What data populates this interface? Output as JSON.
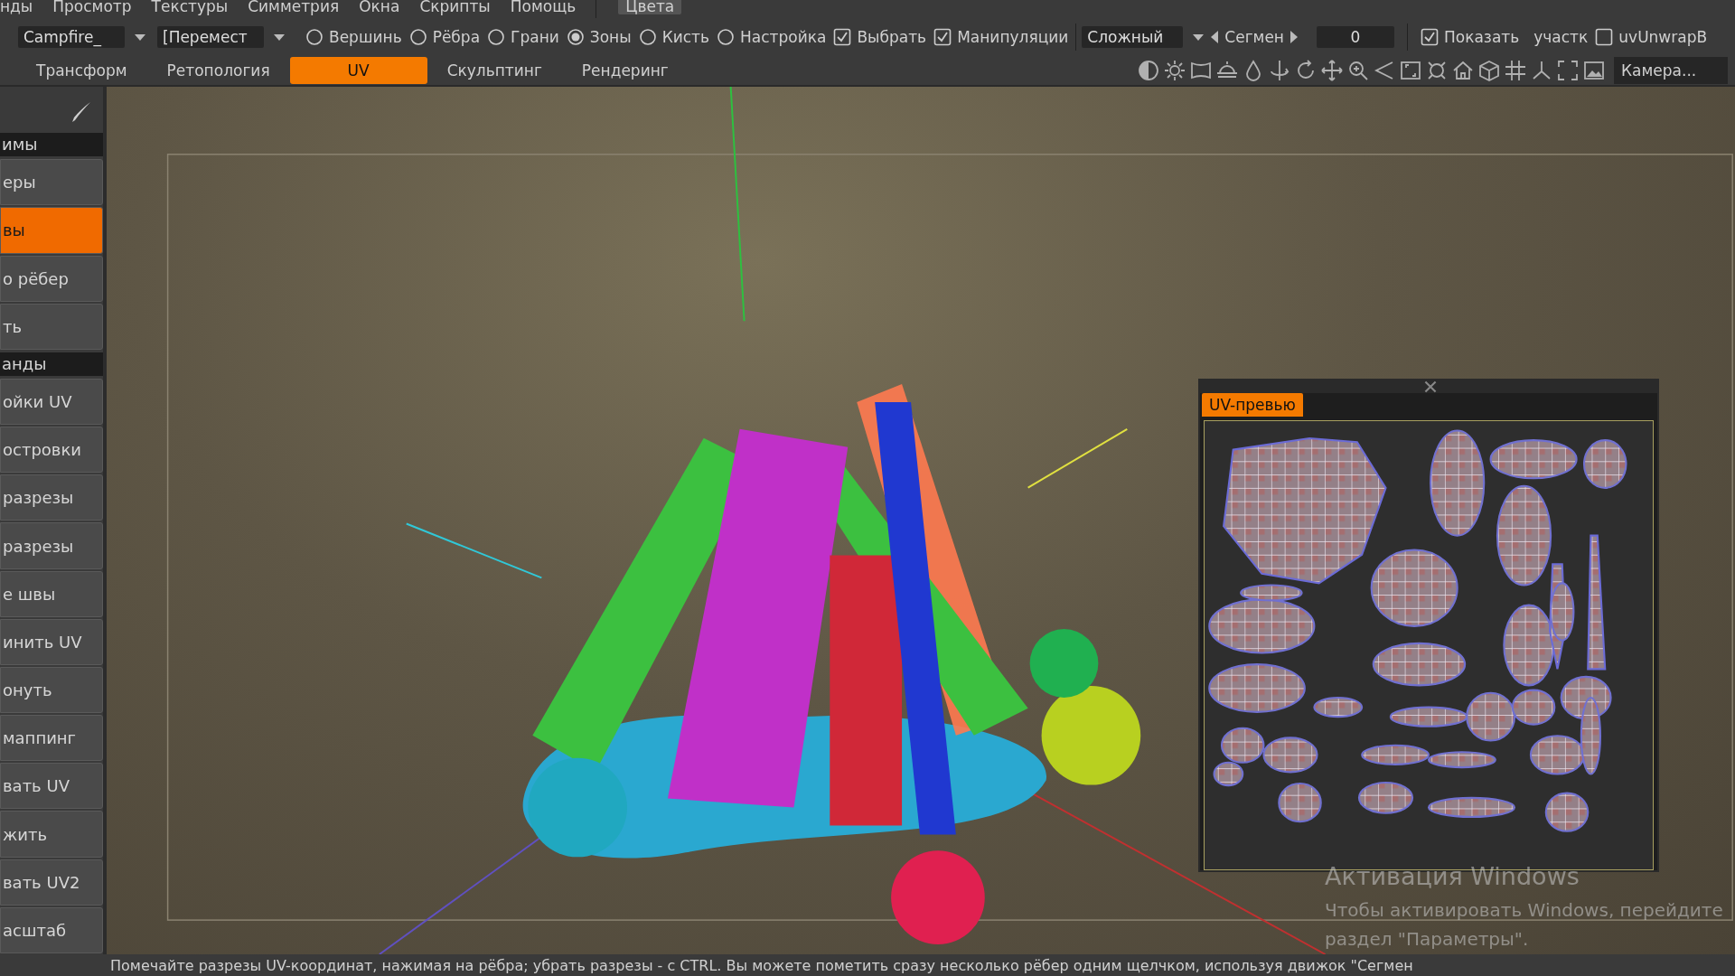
{
  "menu": [
    {
      "label": "нды",
      "highlighted": false
    },
    {
      "label": "Просмотр",
      "highlighted": false
    },
    {
      "label": "Текстуры",
      "highlighted": false
    },
    {
      "label": "Симметрия",
      "highlighted": false
    },
    {
      "label": "Окна",
      "highlighted": false
    },
    {
      "label": "Скрипты",
      "highlighted": false
    },
    {
      "label": "Помощь",
      "highlighted": false
    },
    {
      "label": "Цвета",
      "highlighted": true
    }
  ],
  "toolbar": {
    "object_dropdown": "Campfire_",
    "tool_dropdown": "[Перемест",
    "modes": [
      {
        "label": "Вершинь",
        "selected": false
      },
      {
        "label": "Рёбра",
        "selected": false
      },
      {
        "label": "Грани",
        "selected": false
      },
      {
        "label": "Зоны",
        "selected": true
      },
      {
        "label": "Кисть",
        "selected": false
      },
      {
        "label": "Настройка",
        "selected": false
      }
    ],
    "checks": [
      {
        "label": "Выбрать",
        "checked": true
      },
      {
        "label": "Манипуляции",
        "checked": true
      }
    ],
    "mode_dropdown": "Сложный",
    "segment_label": "Сегмен",
    "segment_value": "0",
    "show_check": {
      "label": "Показать",
      "checked": true
    },
    "show_label": "участк",
    "unwrap_check": {
      "label": "uvUnwrapB",
      "checked": false
    }
  },
  "tabs": [
    {
      "label": "Трансформ",
      "selected": false
    },
    {
      "label": "Ретопология",
      "selected": false
    },
    {
      "label": "UV",
      "selected": true
    },
    {
      "label": "Скульптинг",
      "selected": false
    },
    {
      "label": "Рендеринг",
      "selected": false
    }
  ],
  "camera_dropdown": "Камера...",
  "sidebar": [
    {
      "kind": "header",
      "label": "имы"
    },
    {
      "kind": "item",
      "label": "еры",
      "selected": false
    },
    {
      "kind": "item",
      "label": "вы",
      "selected": true
    },
    {
      "kind": "item",
      "label": "о рёбер",
      "selected": false
    },
    {
      "kind": "item",
      "label": "ть",
      "selected": false
    },
    {
      "kind": "header",
      "label": "анды"
    },
    {
      "kind": "item",
      "label": "ойки UV",
      "selected": false
    },
    {
      "kind": "item",
      "label": "островки",
      "selected": false
    },
    {
      "kind": "item",
      "label": "разрезы",
      "selected": false
    },
    {
      "kind": "item",
      "label": "разрезы",
      "selected": false
    },
    {
      "kind": "item",
      "label": "е швы",
      "selected": false
    },
    {
      "kind": "item",
      "label": "инить UV",
      "selected": false
    },
    {
      "kind": "item",
      "label": "онуть",
      "selected": false
    },
    {
      "kind": "item",
      "label": "маппинг",
      "selected": false
    },
    {
      "kind": "item",
      "label": "вать UV",
      "selected": false
    },
    {
      "kind": "item",
      "label": "жить",
      "selected": false
    },
    {
      "kind": "item",
      "label": "вать UV2",
      "selected": false
    },
    {
      "kind": "item",
      "label": "асштаб",
      "selected": false
    }
  ],
  "uv_preview": {
    "title": "UV-превью"
  },
  "os_notice": {
    "title": "Активация Windows",
    "lines": [
      "Чтобы активировать Windows, перейдите",
      "раздел \"Параметры\"."
    ]
  },
  "status_bar": "Помечайте разрезы UV-координат, нажимая на рёбра; убрать разрезы - с CTRL. Вы можете пометить сразу несколько рёбер одним щелчком, используя движок \"Сегмен"
}
